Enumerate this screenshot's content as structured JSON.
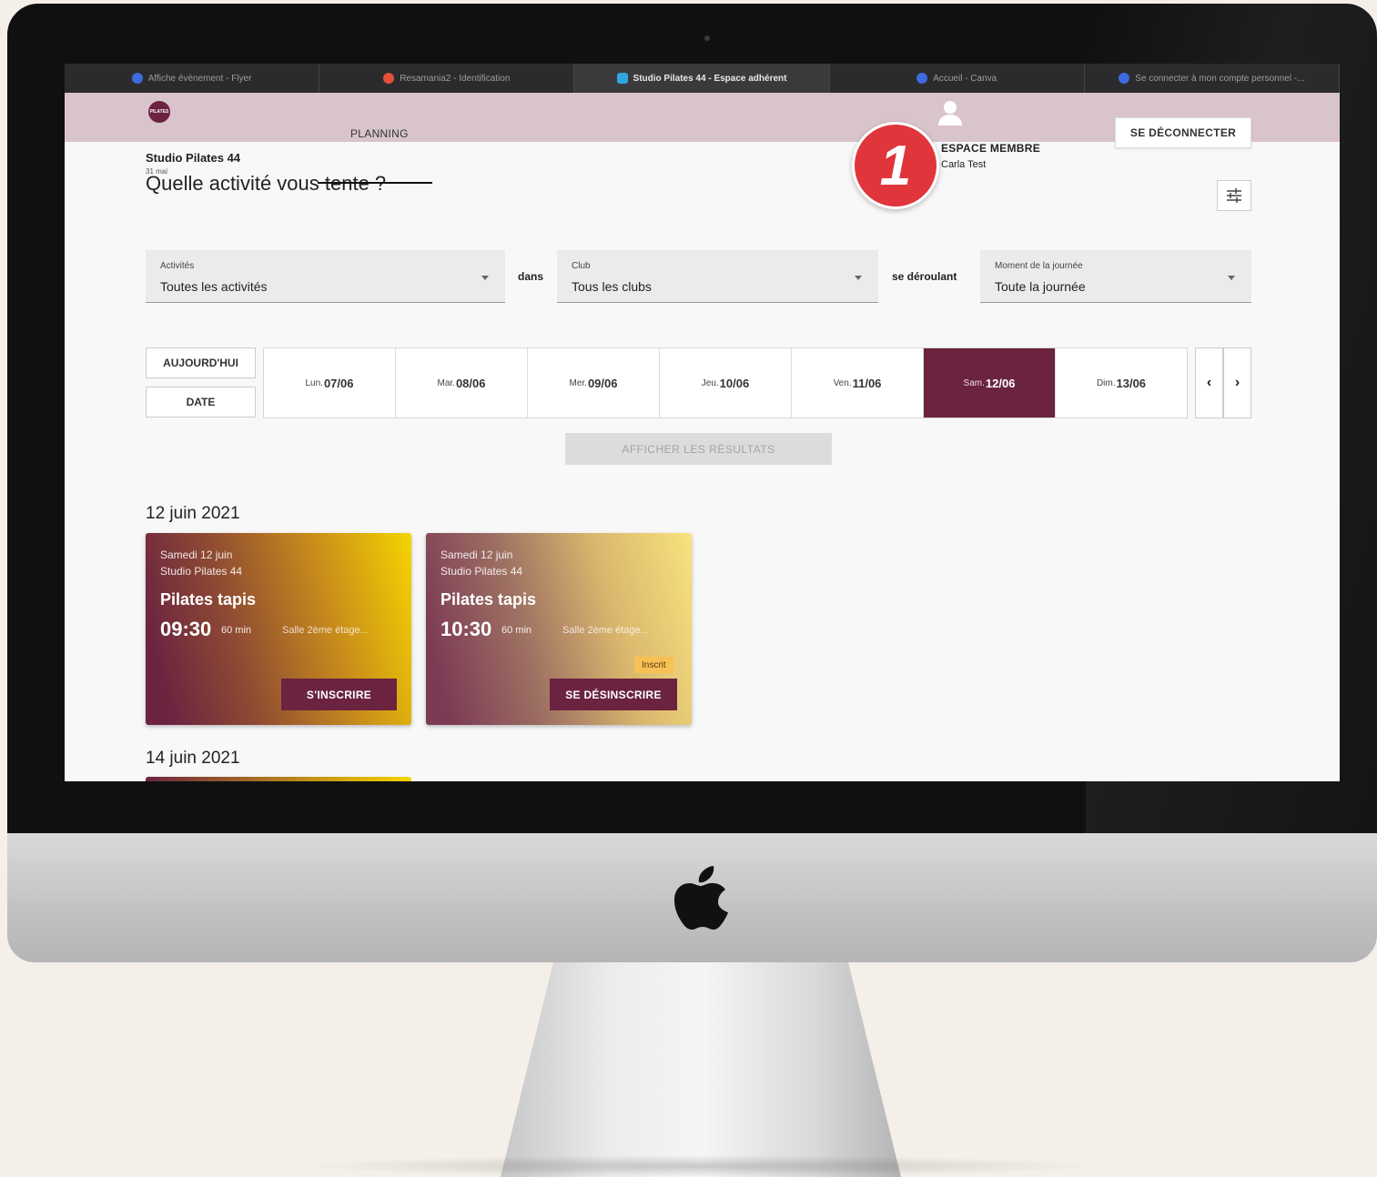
{
  "browser": {
    "tabs": [
      {
        "label": "Affiche évènement - Flyer",
        "icon": "canva-icon",
        "active": false
      },
      {
        "label": "Resamania2 - Identification",
        "icon": "gear-icon",
        "active": false
      },
      {
        "label": "Studio Pilates 44 - Espace adhérent",
        "icon": "studio-icon",
        "active": true
      },
      {
        "label": "Accueil - Canva",
        "icon": "canva-icon",
        "active": false
      },
      {
        "label": "Se connecter à mon compte personnel -...",
        "icon": "canva-icon",
        "active": false
      }
    ]
  },
  "header": {
    "logo_text": "PILATES",
    "nav_planning": "PLANNING",
    "member_title": "ESPACE MEMBRE",
    "member_name": "Carla Test",
    "logout_label": "SE DÉCONNECTER",
    "step_number": "1"
  },
  "page": {
    "studio_name": "Studio Pilates 44",
    "small_date": "31 mai",
    "question": "Quelle activité vous tente ?"
  },
  "filters": {
    "activities": {
      "label": "Activités",
      "value": "Toutes les activités"
    },
    "joiner_1": "dans",
    "club": {
      "label": "Club",
      "value": "Tous les clubs"
    },
    "joiner_2": "se déroulant",
    "moment": {
      "label": "Moment de la journée",
      "value": "Toute la journée"
    }
  },
  "date_nav": {
    "today_label": "AUJOURD'HUI",
    "date_label": "DATE",
    "days": [
      {
        "prefix": "Lun.",
        "date": "07/06",
        "selected": false
      },
      {
        "prefix": "Mar.",
        "date": "08/06",
        "selected": false
      },
      {
        "prefix": "Mer.",
        "date": "09/06",
        "selected": false
      },
      {
        "prefix": "Jeu.",
        "date": "10/06",
        "selected": false
      },
      {
        "prefix": "Ven.",
        "date": "11/06",
        "selected": false
      },
      {
        "prefix": "Sam.",
        "date": "12/06",
        "selected": true
      },
      {
        "prefix": "Dim.",
        "date": "13/06",
        "selected": false
      }
    ],
    "prev_icon": "chevron-left-icon",
    "next_icon": "chevron-right-icon",
    "results_label": "AFFICHER LES RÉSULTATS"
  },
  "sessions": [
    {
      "date_heading": "12 juin 2021",
      "cards": [
        {
          "day": "Samedi 12 juin",
          "studio": "Studio Pilates 44",
          "course": "Pilates tapis",
          "time": "09:30",
          "duration": "60 min",
          "room": "Salle 2ème étage...",
          "badge": "",
          "action": "S'INSCRIRE"
        },
        {
          "day": "Samedi 12 juin",
          "studio": "Studio Pilates 44",
          "course": "Pilates tapis",
          "time": "10:30",
          "duration": "60 min",
          "room": "Salle 2ème étage...",
          "badge": "Inscrit",
          "action": "SE DÉSINSCRIRE"
        }
      ]
    },
    {
      "date_heading": "14 juin 2021",
      "cards": []
    }
  ],
  "colors": {
    "brand": "#6b2340",
    "header_bg": "#d9c4cc",
    "badge": "#f8c155",
    "step_badge": "#e0353b"
  }
}
